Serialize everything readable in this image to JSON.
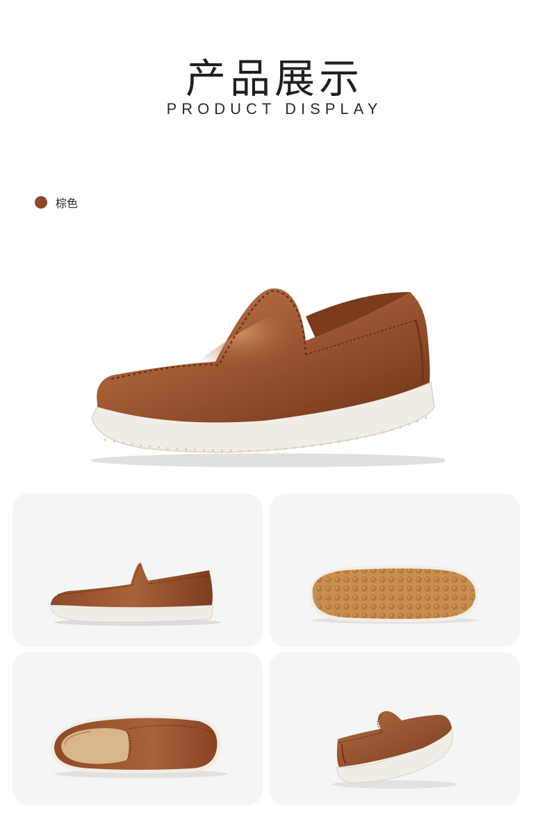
{
  "header": {
    "title": "产品展示",
    "subtitle": "PRODUCT DISPLAY"
  },
  "color_option": {
    "label": "棕色",
    "swatch_color": "#8a4a2a"
  },
  "colors": {
    "leather": "#9c5530",
    "leather_dark": "#6e3418",
    "leather_light": "#c27a4c",
    "sole": "#f1ede6",
    "outsole_gum": "#c8904f",
    "tile_bg": "#f5f5f5"
  },
  "images": {
    "hero": "brown-leather-loafer-three-quarter-view",
    "side": "brown-leather-loafer-side-view",
    "sole": "loafer-outsole-bottom-view",
    "top": "loafer-top-view",
    "back": "loafer-rear-three-quarter-view"
  }
}
